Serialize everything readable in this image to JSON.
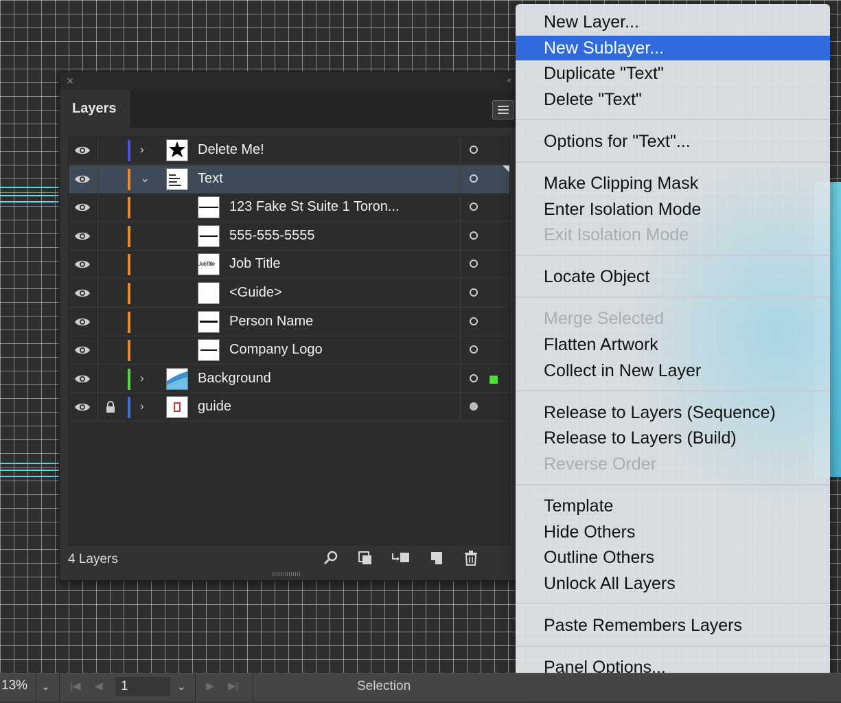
{
  "panel": {
    "tab_label": "Layers",
    "layer_count": "4 Layers",
    "rows": [
      {
        "name": "Delete Me!",
        "color": "#4a53e8",
        "expanded": "collapsed",
        "level": 0,
        "target": "hollow",
        "locked": false,
        "selected": false
      },
      {
        "name": "Text",
        "color": "#f28a2c",
        "expanded": "expanded",
        "level": 0,
        "target": "hollow",
        "locked": false,
        "selected": true
      },
      {
        "name": "123 Fake St Suite 1 Toron...",
        "color": "#f28a2c",
        "expanded": "none",
        "level": 1,
        "target": "hollow",
        "locked": false,
        "selected": false
      },
      {
        "name": "555-555-5555",
        "color": "#f28a2c",
        "expanded": "none",
        "level": 1,
        "target": "hollow",
        "locked": false,
        "selected": false
      },
      {
        "name": "Job Title",
        "color": "#f28a2c",
        "expanded": "none",
        "level": 1,
        "target": "hollow",
        "locked": false,
        "selected": false
      },
      {
        "name": "<Guide>",
        "color": "#f28a2c",
        "expanded": "none",
        "level": 1,
        "target": "hollow",
        "locked": false,
        "selected": false
      },
      {
        "name": "Person Name",
        "color": "#f28a2c",
        "expanded": "none",
        "level": 1,
        "target": "hollow",
        "locked": false,
        "selected": false
      },
      {
        "name": "Company Logo",
        "color": "#f28a2c",
        "expanded": "none",
        "level": 1,
        "target": "hollow",
        "locked": false,
        "selected": false
      },
      {
        "name": "Background",
        "color": "#4ddc3a",
        "expanded": "collapsed",
        "level": 0,
        "target": "hollow",
        "locked": false,
        "selected": false
      },
      {
        "name": "guide",
        "color": "#3f6fe0",
        "expanded": "collapsed",
        "level": 0,
        "target": "filled",
        "locked": true,
        "selected": false
      }
    ],
    "thumb_text": {
      "job_title": "JobTitle"
    }
  },
  "context_menu": {
    "items": [
      {
        "label": "New Layer...",
        "state": "normal"
      },
      {
        "label": "New Sublayer...",
        "state": "highlighted"
      },
      {
        "label": "Duplicate \"Text\"",
        "state": "normal"
      },
      {
        "label": "Delete \"Text\"",
        "state": "normal"
      },
      {
        "sep": true
      },
      {
        "label": "Options for \"Text\"...",
        "state": "normal"
      },
      {
        "sep": true
      },
      {
        "label": "Make Clipping Mask",
        "state": "normal"
      },
      {
        "label": "Enter Isolation Mode",
        "state": "normal"
      },
      {
        "label": "Exit Isolation Mode",
        "state": "disabled"
      },
      {
        "sep": true
      },
      {
        "label": "Locate Object",
        "state": "normal"
      },
      {
        "sep": true
      },
      {
        "label": "Merge Selected",
        "state": "disabled"
      },
      {
        "label": "Flatten Artwork",
        "state": "normal"
      },
      {
        "label": "Collect in New Layer",
        "state": "normal"
      },
      {
        "sep": true
      },
      {
        "label": "Release to Layers (Sequence)",
        "state": "normal"
      },
      {
        "label": "Release to Layers (Build)",
        "state": "normal"
      },
      {
        "label": "Reverse Order",
        "state": "disabled"
      },
      {
        "sep": true
      },
      {
        "label": "Template",
        "state": "normal"
      },
      {
        "label": "Hide Others",
        "state": "normal"
      },
      {
        "label": "Outline Others",
        "state": "normal"
      },
      {
        "label": "Unlock All Layers",
        "state": "normal"
      },
      {
        "sep": true
      },
      {
        "label": "Paste Remembers Layers",
        "state": "normal"
      },
      {
        "sep": true
      },
      {
        "label": "Panel Options...",
        "state": "normal"
      }
    ]
  },
  "status_bar": {
    "zoom": "13%",
    "artboard_number": "1",
    "current_tool": "Selection"
  },
  "colors": {
    "highlight": "#2f6bde",
    "panel_bg": "#323232",
    "selected_row": "#3e4a57"
  }
}
